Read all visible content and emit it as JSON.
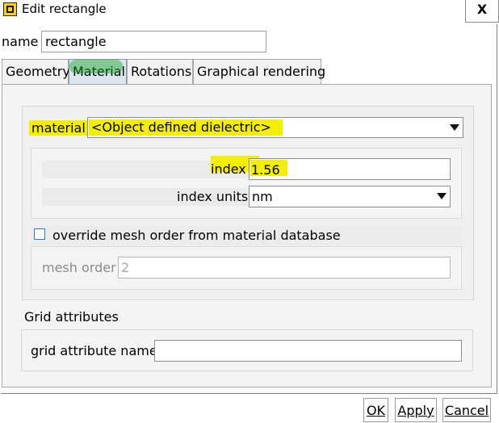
{
  "window": {
    "title": "Edit rectangle",
    "close_glyph": "X",
    "app_icon": "square-icon"
  },
  "name_field": {
    "label": "name",
    "value": "rectangle"
  },
  "tabs": [
    {
      "label": "Geometry",
      "active": false
    },
    {
      "label": "Material",
      "active": true
    },
    {
      "label": "Rotations",
      "active": false
    },
    {
      "label": "Graphical rendering",
      "active": false
    }
  ],
  "material": {
    "label": "material",
    "selected": "<Object defined dielectric>",
    "index": {
      "label": "index",
      "value": "1.56"
    },
    "index_units": {
      "label": "index units",
      "selected": "nm"
    },
    "override": {
      "label": "override mesh order from material database",
      "checked": false
    },
    "mesh_order": {
      "label": "mesh order",
      "value": "2"
    }
  },
  "grid": {
    "title": "Grid attributes",
    "name_label": "grid attribute name",
    "name_value": ""
  },
  "buttons": {
    "ok": "OK",
    "apply": "Apply",
    "cancel": "Cancel"
  },
  "colors": {
    "highlight_yellow": "#f4ef00",
    "highlight_green": "#14a51e",
    "checkbox_blue": "#2c7ad6"
  }
}
